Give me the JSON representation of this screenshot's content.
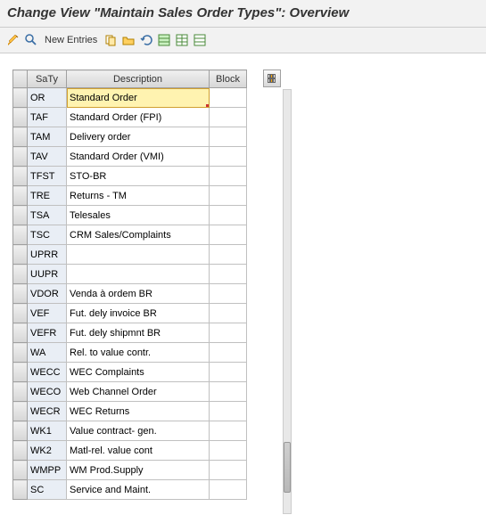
{
  "header": {
    "title": "Change View \"Maintain Sales Order Types\": Overview"
  },
  "toolbar": {
    "new_entries": "New Entries"
  },
  "columns": {
    "saty": "SaTy",
    "description": "Description",
    "block": "Block"
  },
  "rows": [
    {
      "saty": "OR",
      "desc": "Standard Order",
      "active": true
    },
    {
      "saty": "TAF",
      "desc": "Standard Order (FPI)"
    },
    {
      "saty": "TAM",
      "desc": "Delivery order"
    },
    {
      "saty": "TAV",
      "desc": "Standard Order (VMI)"
    },
    {
      "saty": "TFST",
      "desc": "STO-BR"
    },
    {
      "saty": "TRE",
      "desc": "Returns - TM"
    },
    {
      "saty": "TSA",
      "desc": "Telesales"
    },
    {
      "saty": "TSC",
      "desc": "CRM Sales/Complaints"
    },
    {
      "saty": "UPRR",
      "desc": ""
    },
    {
      "saty": "UUPR",
      "desc": ""
    },
    {
      "saty": "VDOR",
      "desc": "Venda à ordem BR"
    },
    {
      "saty": "VEF",
      "desc": "Fut. dely invoice BR"
    },
    {
      "saty": "VEFR",
      "desc": "Fut. dely shipmnt BR"
    },
    {
      "saty": "WA",
      "desc": "Rel. to value contr."
    },
    {
      "saty": "WECC",
      "desc": "WEC Complaints"
    },
    {
      "saty": "WECO",
      "desc": "Web Channel Order"
    },
    {
      "saty": "WECR",
      "desc": "WEC Returns"
    },
    {
      "saty": "WK1",
      "desc": "Value contract- gen."
    },
    {
      "saty": "WK2",
      "desc": "Matl-rel. value cont"
    },
    {
      "saty": "WMPP",
      "desc": "WM Prod.Supply"
    },
    {
      "saty": "SC",
      "desc": "Service and Maint."
    }
  ]
}
